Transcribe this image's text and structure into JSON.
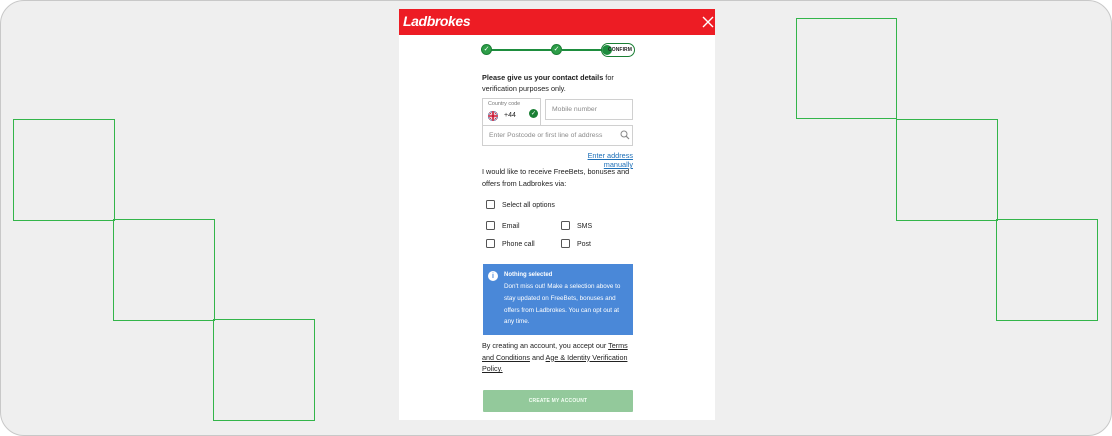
{
  "header": {
    "brand": "Ladbrokes",
    "brand_color": "#ed1c24",
    "close_icon": "close-icon"
  },
  "stepper": {
    "steps": [
      {
        "state": "done"
      },
      {
        "state": "done"
      },
      {
        "state": "current",
        "label": "CONFIRM"
      }
    ],
    "accent": "#1e8d3e"
  },
  "contact": {
    "intro_bold": "Please give us your contact details",
    "intro_rest": " for verification purposes only.",
    "country_code_label": "Country code",
    "country_code_value": "+44",
    "mobile_placeholder": "Mobile number",
    "address_placeholder": "Enter Postcode or first line of address",
    "enter_manually": "Enter address manually"
  },
  "marketing": {
    "prompt": "I would like to receive FreeBets, bonuses and offers from Ladbrokes via:",
    "select_all": "Select all options",
    "options": [
      "Email",
      "SMS",
      "Phone call",
      "Post"
    ]
  },
  "info": {
    "title": "Nothing selected",
    "body": "Don't miss out! Make a selection above to stay updated on FreeBets, bonuses and offers from Ladbrokes. You can opt out at any time.",
    "color": "#4a88d8"
  },
  "terms": {
    "prefix": "By creating an account, you accept our ",
    "link1": "Terms and Conditions",
    "middle": " and ",
    "link2": "Age & Identity Verification Policy."
  },
  "cta": {
    "label": "CREATE MY ACCOUNT",
    "color": "#93c99b"
  }
}
